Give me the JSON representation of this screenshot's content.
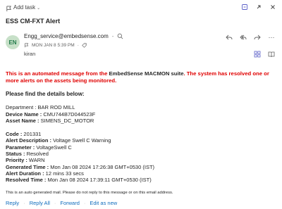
{
  "toolbar": {
    "add_task_label": "Add task",
    "caret": "⌄",
    "icons": [
      "note-icon",
      "expand-icon",
      "close-icon"
    ]
  },
  "email": {
    "subject": "ESS CM-FXT Alert",
    "avatar_initials": "EN",
    "sender": "Engg_service@embedsense.com",
    "timestamp": "MON JAN 8 5:39 PM",
    "to": "kiran"
  },
  "body": {
    "notice_pre": "This is an automated message from the ",
    "notice_brand": "EmbedSense MACMON suite",
    "notice_post": ". The system has resolved one or more alerts on the assets being monitored.",
    "details_heading": "Please find the details below:",
    "asset": [
      {
        "label": "Department :",
        "value": " BAR ROD MILL"
      },
      {
        "label": "Device Name :",
        "value": " CMU744B7D044523F"
      },
      {
        "label": "Asset Name :",
        "value": " SIMENS_DC_MOTOR"
      }
    ],
    "alert": [
      {
        "label": "Code :",
        "value": " 201331"
      },
      {
        "label": "Alert Description :",
        "value": " Voltage Swell C Warning"
      },
      {
        "label": "Parameter :",
        "value": " VoltageSwell C"
      },
      {
        "label": "Status :",
        "value": " Resolved"
      },
      {
        "label": "Priority :",
        "value": " WARN"
      },
      {
        "label": "Generated Time :",
        "value": " Mon Jan 08 2024 17:26:38 GMT+0530 (IST)"
      },
      {
        "label": "Alert Duration :",
        "value": " 12 mins 33 secs"
      },
      {
        "label": "Resolved Time :",
        "value": " Mon Jan 08 2024 17:39:11 GMT+0530 (IST)"
      }
    ],
    "footer_note": "This is an auto generated mail. Please do not reply to this message or on this email address."
  },
  "reply_bar": {
    "reply": "Reply",
    "reply_all": "Reply All",
    "forward": "Forward",
    "edit_as_new": "Edit as new"
  },
  "colors": {
    "accent": "#5b5fc7",
    "alert_red": "#e00000",
    "link_blue": "#0f6cbd",
    "avatar_bg": "#c7e0c8"
  }
}
